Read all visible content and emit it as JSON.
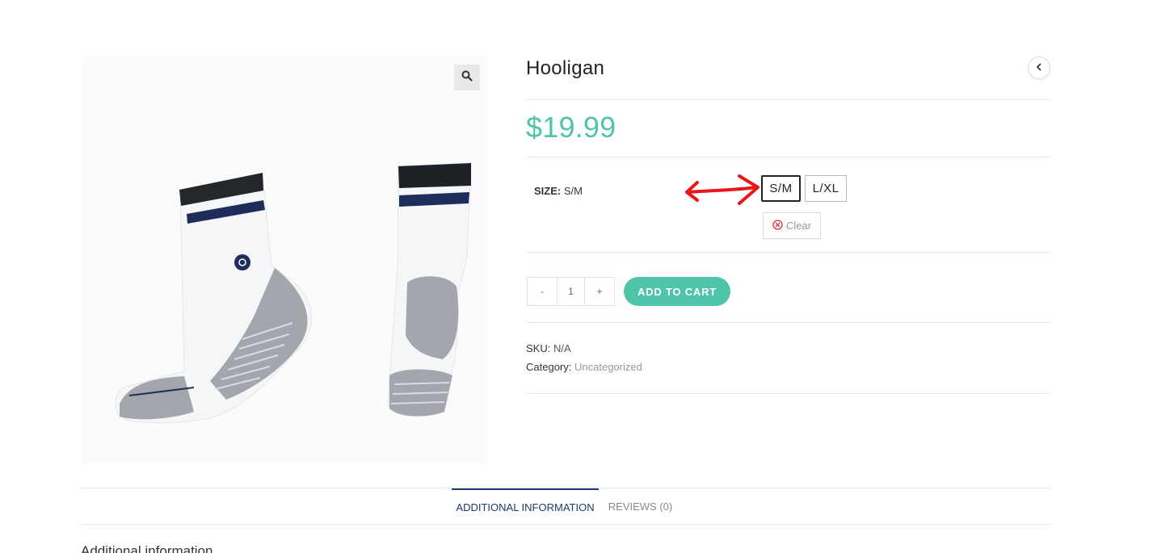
{
  "product": {
    "title": "Hooligan",
    "price": "$19.99",
    "image_alt": "white crew socks with navy and black stripes"
  },
  "variation": {
    "label": "SIZE:",
    "selected_value": "S/M",
    "options": [
      "S/M",
      "L/XL"
    ],
    "clear_label": "Clear"
  },
  "cart": {
    "minus_label": "-",
    "quantity": "1",
    "plus_label": "+",
    "add_to_cart_label": "ADD TO CART"
  },
  "meta": {
    "sku_label": "SKU:",
    "sku_value": "N/A",
    "category_label": "Category:",
    "category_value": "Uncategorized"
  },
  "tabs": [
    {
      "label": "ADDITIONAL INFORMATION"
    },
    {
      "label": "REVIEWS (0)"
    }
  ],
  "section_heading": "Additional information",
  "icons": {
    "zoom": "search-icon",
    "prev": "chevron-left-icon",
    "clear": "clear-circle-icon",
    "annotation": "double-arrow-annotation"
  },
  "colors": {
    "accent": "#4fc4a8",
    "tab_active": "#1d3b6e",
    "annotation": "#e8161b"
  }
}
